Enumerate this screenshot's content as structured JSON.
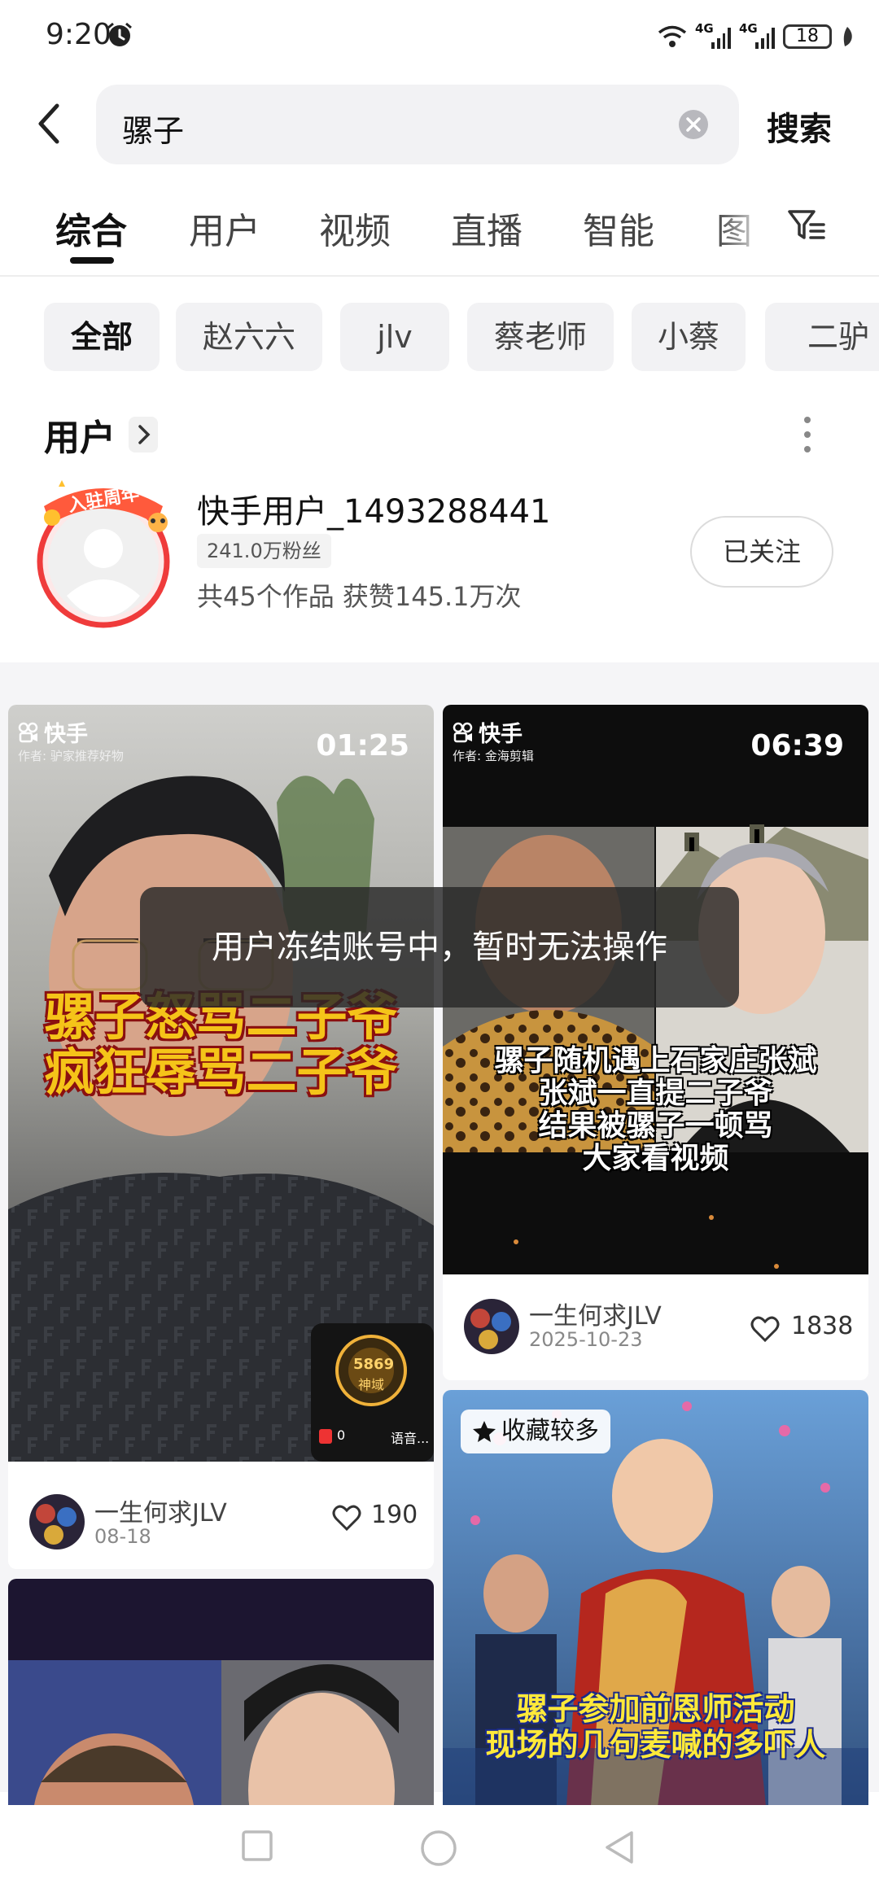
{
  "status_bar": {
    "time": "9:20",
    "network_1": "4G",
    "network_2": "4G",
    "battery": "18"
  },
  "search": {
    "query": "骡子",
    "submit_label": "搜索"
  },
  "tabs": [
    "综合",
    "用户",
    "视频",
    "直播",
    "智能",
    "图"
  ],
  "chips": [
    "全部",
    "赵六六",
    "jlv",
    "蔡老师",
    "小蔡",
    "二驴"
  ],
  "users_section": {
    "title": "用户",
    "user": {
      "name": "快手用户_1493288441",
      "avatar_badge": "入驻周年",
      "fans": "241.0万粉丝",
      "stats": "共45个作品 获赞145.1万次",
      "follow_label": "已关注"
    }
  },
  "feed": {
    "cards": [
      {
        "brand": "快手",
        "author": "作者: 驴家推荐好物",
        "duration": "01:25",
        "caption_lines": [
          "骡子怒骂二子爷",
          "疯狂辱骂二子爷"
        ],
        "overlay_badge": "5869",
        "overlay_badge_sub": "神域",
        "live_count": "0",
        "live_label": "语音...",
        "user": "一生何求JLV",
        "date": "08-18",
        "likes": "190"
      },
      {
        "brand": "快手",
        "author": "作者: 金海剪辑",
        "duration": "06:39",
        "caption_lines": [
          "骡子随机遇上石家庄张斌",
          "张斌一直提二子爷",
          "结果被骡子一顿骂",
          "大家看视频"
        ],
        "user": "一生何求JLV",
        "date": "2025-10-23",
        "likes": "1838"
      },
      {
        "badge": "收藏较多",
        "caption_lines": [
          "骡子参加前恩师活动",
          "现场的几句麦喊的多吓人"
        ]
      }
    ]
  },
  "toast": "用户冻结账号中，暂时无法操作",
  "colors": {
    "accent_text": "#111111",
    "caption_yellow": "#f5c419",
    "caption_red_outline": "#8a1010",
    "chip_bg": "#f2f2f4"
  }
}
